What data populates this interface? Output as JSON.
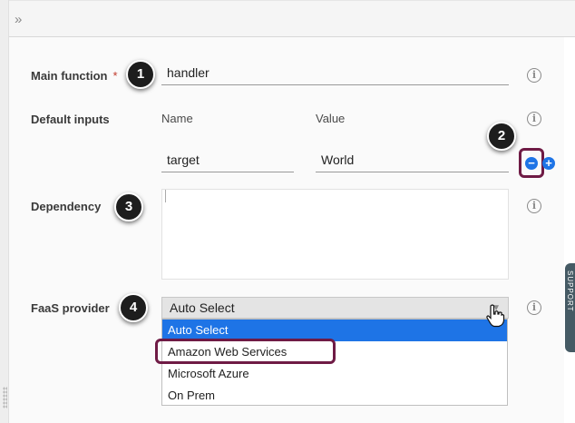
{
  "topbar": {
    "expand_icon": "»"
  },
  "form": {
    "main_function": {
      "label": "Main function",
      "required_mark": "*",
      "value": "handler",
      "callout": "1"
    },
    "default_inputs": {
      "label": "Default inputs",
      "name_header": "Name",
      "value_header": "Value",
      "rows": [
        {
          "name": "target",
          "value": "World"
        }
      ],
      "callout": "2",
      "remove_icon": "−",
      "add_icon": "+"
    },
    "dependency": {
      "label": "Dependency",
      "value": "",
      "callout": "3"
    },
    "faas_provider": {
      "label": "FaaS provider",
      "selected": "Auto Select",
      "callout": "4",
      "options": [
        "Auto Select",
        "Amazon Web Services",
        "Microsoft Azure",
        "On Prem"
      ]
    }
  },
  "support_tab": {
    "label": "SUPPORT"
  },
  "colors": {
    "accent": "#1e74e6",
    "highlight": "#6f1b45",
    "required": "#c0392b"
  }
}
